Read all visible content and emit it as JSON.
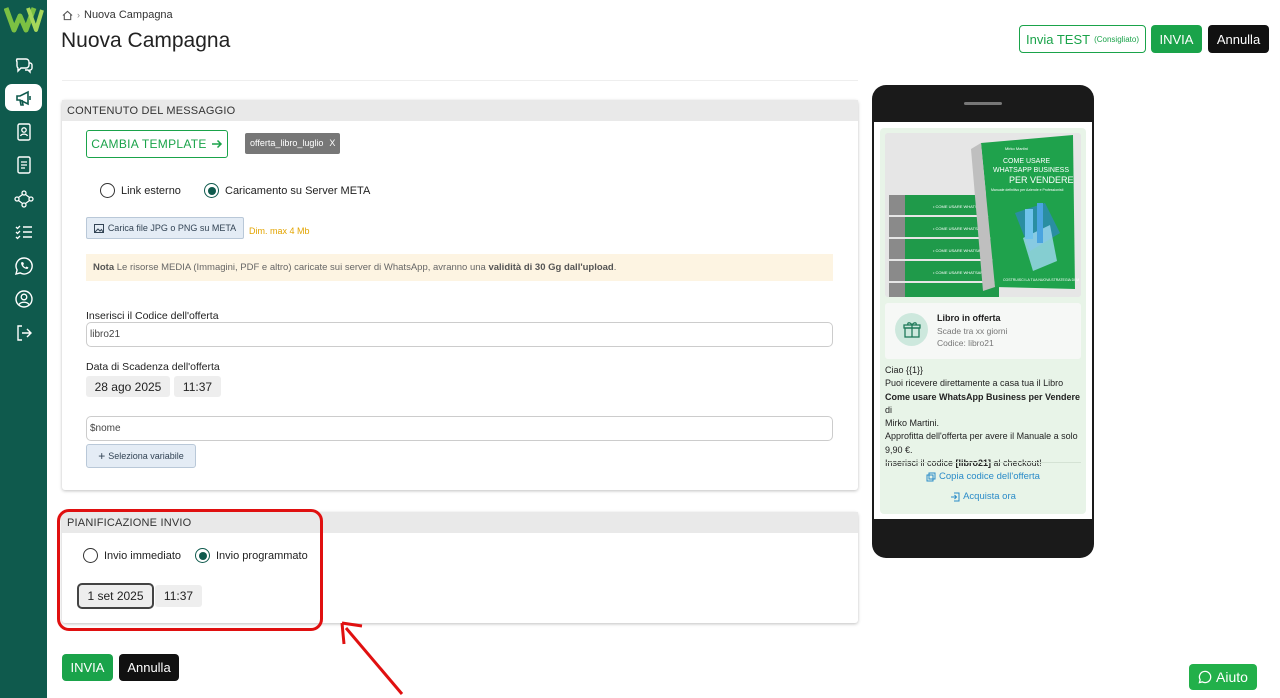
{
  "header": {
    "breadcrumb": "Nuova Campagna",
    "title": "Nuova Campagna",
    "test_label": "Invia TEST",
    "test_hint": "(Consigliato)",
    "send_label": "INVIA",
    "cancel_label": "Annulla"
  },
  "content": {
    "section_title": "CONTENUTO DEL MESSAGGIO",
    "change_template": "CAMBIA TEMPLATE",
    "template_tag": "offerta_libro_luglio",
    "template_tag_close": "X",
    "radio_external": "Link esterno",
    "radio_meta": "Caricamento su Server META",
    "upload_label": "Carica file JPG o PNG su META",
    "upload_limit": "Dim. max 4 Mb",
    "note_label": "Nota",
    "note_text": " Le risorse MEDIA (Immagini, PDF e altro) caricate sui server di WhatsApp, avranno una ",
    "note_bold": "validità di 30 Gg dall'upload",
    "note_end": ".",
    "code_label": "Inserisci il Codice dell'offerta",
    "code_value": "libro21",
    "expiry_label": "Data di Scadenza dell'offerta",
    "expiry_date": "28 ago 2025",
    "expiry_time": "11:37",
    "variable_value": "$nome",
    "variable_button": "Seleziona variabile"
  },
  "schedule": {
    "section_title": "PIANIFICAZIONE INVIO",
    "radio_now": "Invio immediato",
    "radio_scheduled": "Invio programmato",
    "date": "1 set 2025",
    "time": "11:37"
  },
  "footer": {
    "send_label": "INVIA",
    "cancel_label": "Annulla",
    "help_label": "Aiuto"
  },
  "preview": {
    "book_top": "Mirko Martini",
    "book_title_1": "COME USARE",
    "book_title_2": "WHATSAPP BUSINESS",
    "book_title_3": "PER VENDERE",
    "book_subtitle": "Manuale definitivo per Aziende e Professionisti",
    "book_spine": "• COME USARE WHATSAPP",
    "book_bottom": "COSTRUISCI LA TUA NUOVA STRATEGIA DI M",
    "offer_title": "Libro in offerta",
    "offer_subtitle": "Scade tra xx giorni",
    "offer_code": "Codice: libro21",
    "msg_greeting": "Ciao {{1}}",
    "msg_line1": "Puoi ricevere direttamente a casa tua il Libro",
    "msg_book": "Come usare WhatsApp Business per Vendere",
    "msg_line2": " di",
    "msg_author": "Mirko Martini.",
    "msg_line3": "Approfitta dell'offerta per avere il Manuale a solo 9,90 €.",
    "msg_line4a": "Inserisci il codice ",
    "msg_code": "[libro21]",
    "msg_line4b": " al checkout!",
    "copy_link": "Copia codice dell'offerta",
    "buy_link": "Acquista ora"
  },
  "colors": {
    "sidebar": "#0f5a4d",
    "accent_green": "#1aa34a",
    "highlight_red": "#e01010",
    "link_blue": "#2a8bc8"
  },
  "icons": [
    "chat-icon",
    "megaphone-icon",
    "contacts-icon",
    "document-icon",
    "flow-icon",
    "checklist-icon",
    "whatsapp-icon",
    "user-icon",
    "logout-icon"
  ]
}
